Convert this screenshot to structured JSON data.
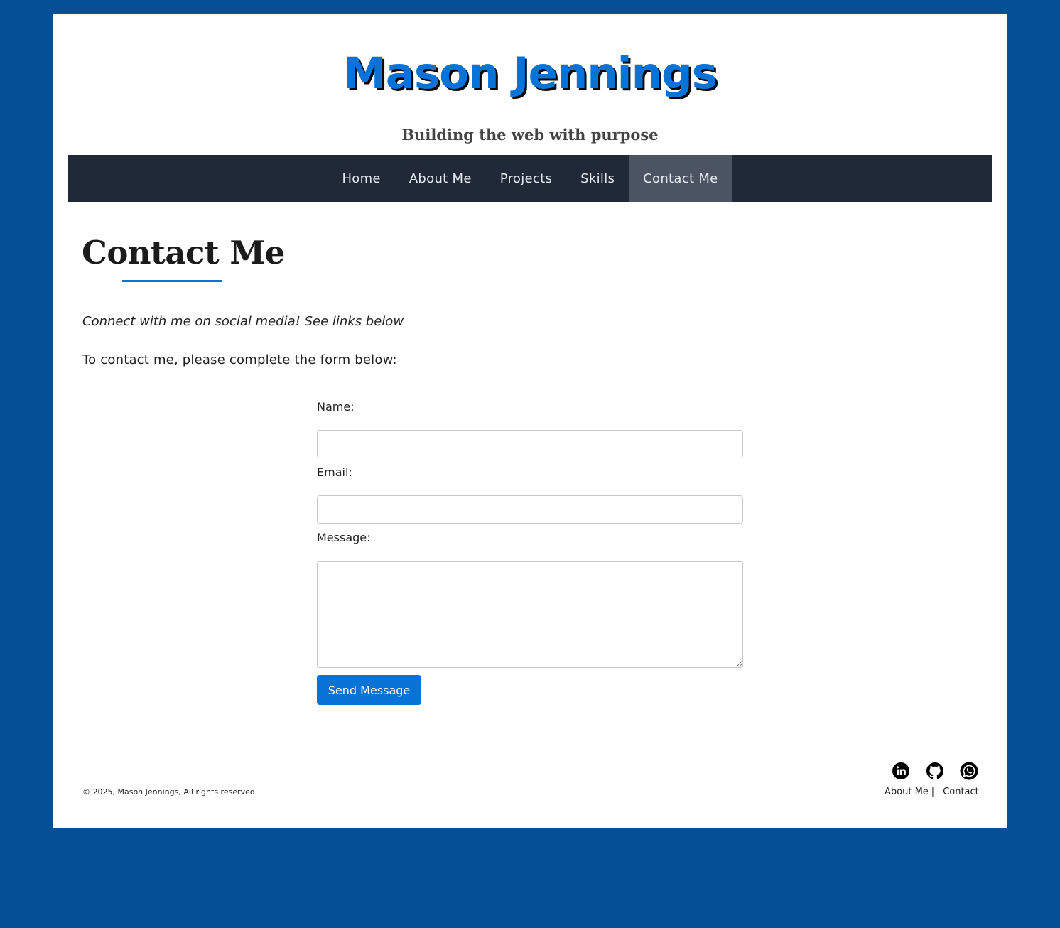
{
  "header": {
    "site_title": "Mason Jennings",
    "tagline": "Building the web with purpose"
  },
  "nav": {
    "items": [
      {
        "label": "Home",
        "active": false
      },
      {
        "label": "About Me",
        "active": false
      },
      {
        "label": "Projects",
        "active": false
      },
      {
        "label": "Skills",
        "active": false
      },
      {
        "label": "Contact Me",
        "active": true
      }
    ]
  },
  "main": {
    "title": "Contact Me",
    "social_note": "Connect with me on social media! See links below",
    "form_intro": "To contact me, please complete the form below:",
    "form": {
      "name_label": "Name:",
      "name_value": "",
      "email_label": "Email:",
      "email_value": "",
      "message_label": "Message:",
      "message_value": "",
      "submit_label": "Send Message"
    }
  },
  "footer": {
    "copyright": "© 2025, Mason Jennings, All rights reserved.",
    "social_icons": [
      "linkedin-icon",
      "github-icon",
      "whatsapp-icon"
    ],
    "links": [
      {
        "label": "About Me"
      },
      {
        "label": "Contact"
      }
    ],
    "separator": "|"
  },
  "colors": {
    "page_background": "#044f96",
    "accent": "#0873d6",
    "nav_background": "#202937",
    "nav_active": "#4b5463"
  }
}
